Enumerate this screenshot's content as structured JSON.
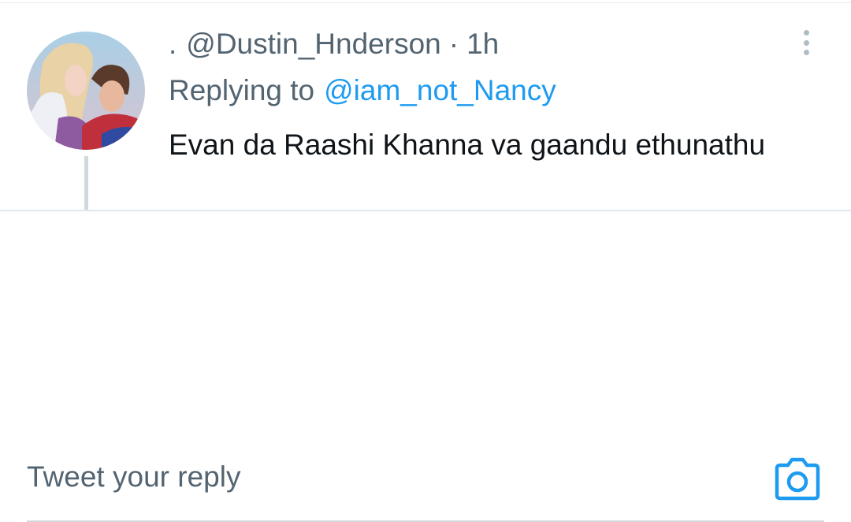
{
  "tweet": {
    "avatar_icon": "user-avatar-photo",
    "display_name": ".",
    "handle": "@Dustin_Hnderson",
    "separator": "·",
    "time": "1h",
    "replying_label": "Replying to",
    "replying_to": "@iam_not_Nancy",
    "text": "Evan da Raashi Khanna va gaandu ethunathu",
    "more_icon": "more-vertical-icon"
  },
  "reply_bar": {
    "placeholder": "Tweet your reply",
    "camera_icon": "camera-icon"
  },
  "colors": {
    "accent": "#1d9bf0",
    "secondary_text": "#536471",
    "primary_text": "#0f1419",
    "divider": "#e1e8ed"
  }
}
